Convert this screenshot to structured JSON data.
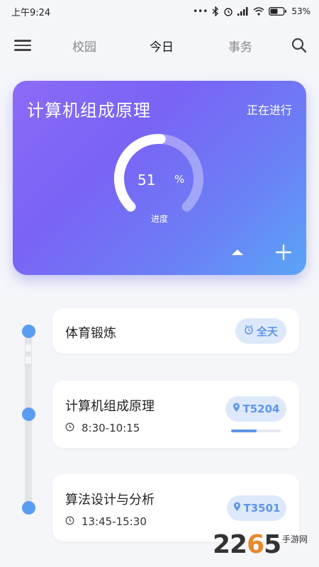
{
  "status_bar": {
    "time": "上午9:24",
    "signal_dots": "•••",
    "battery": "53%"
  },
  "nav": {
    "tabs": [
      {
        "label": "校园",
        "active": false
      },
      {
        "label": "今日",
        "active": true
      },
      {
        "label": "事务",
        "active": false
      }
    ]
  },
  "current_course": {
    "title": "计算机组成原理",
    "status": "正在进行",
    "progress_value": "51",
    "progress_unit": "%",
    "progress_label": "进度",
    "progress_fraction": 0.51
  },
  "events": [
    {
      "title": "体育锻炼",
      "badge_label": "全天",
      "badge_icon": "alarm-clock-icon"
    },
    {
      "title": "计算机组成原理",
      "time": "8:30-10:15",
      "badge_label": "T5204",
      "badge_icon": "location-pin-icon",
      "progress_fraction": 0.51
    },
    {
      "title": "算法设计与分析",
      "time": "13:45-15:30",
      "badge_label": "T3501",
      "badge_icon": "location-pin-icon"
    }
  ],
  "watermark": {
    "brand_prefix": "22",
    "brand_highlight": "6",
    "brand_suffix": "5",
    "brand_sub": "手游网"
  },
  "colors": {
    "accent_blue": "#5e96e8",
    "card_gradient_start": "#8c6bf7",
    "card_gradient_end": "#5aa5f7",
    "badge_bg": "#dde9fb"
  }
}
